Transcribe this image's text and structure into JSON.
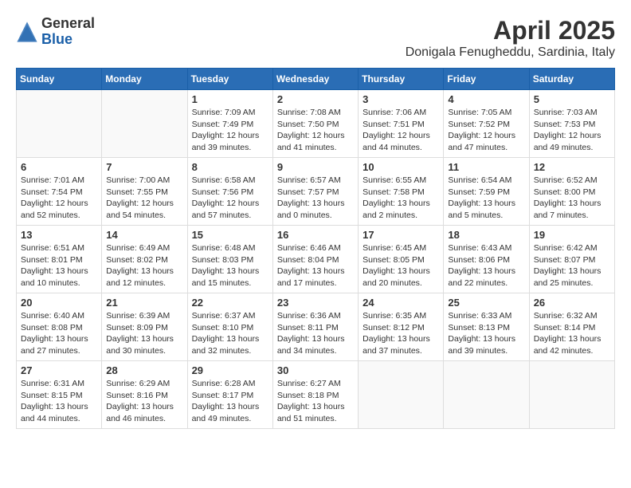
{
  "header": {
    "logo_line1": "General",
    "logo_line2": "Blue",
    "month_title": "April 2025",
    "location": "Donigala Fenugheddu, Sardinia, Italy"
  },
  "weekdays": [
    "Sunday",
    "Monday",
    "Tuesday",
    "Wednesday",
    "Thursday",
    "Friday",
    "Saturday"
  ],
  "weeks": [
    [
      {
        "day": "",
        "info": ""
      },
      {
        "day": "",
        "info": ""
      },
      {
        "day": "1",
        "info": "Sunrise: 7:09 AM\nSunset: 7:49 PM\nDaylight: 12 hours and 39 minutes."
      },
      {
        "day": "2",
        "info": "Sunrise: 7:08 AM\nSunset: 7:50 PM\nDaylight: 12 hours and 41 minutes."
      },
      {
        "day": "3",
        "info": "Sunrise: 7:06 AM\nSunset: 7:51 PM\nDaylight: 12 hours and 44 minutes."
      },
      {
        "day": "4",
        "info": "Sunrise: 7:05 AM\nSunset: 7:52 PM\nDaylight: 12 hours and 47 minutes."
      },
      {
        "day": "5",
        "info": "Sunrise: 7:03 AM\nSunset: 7:53 PM\nDaylight: 12 hours and 49 minutes."
      }
    ],
    [
      {
        "day": "6",
        "info": "Sunrise: 7:01 AM\nSunset: 7:54 PM\nDaylight: 12 hours and 52 minutes."
      },
      {
        "day": "7",
        "info": "Sunrise: 7:00 AM\nSunset: 7:55 PM\nDaylight: 12 hours and 54 minutes."
      },
      {
        "day": "8",
        "info": "Sunrise: 6:58 AM\nSunset: 7:56 PM\nDaylight: 12 hours and 57 minutes."
      },
      {
        "day": "9",
        "info": "Sunrise: 6:57 AM\nSunset: 7:57 PM\nDaylight: 13 hours and 0 minutes."
      },
      {
        "day": "10",
        "info": "Sunrise: 6:55 AM\nSunset: 7:58 PM\nDaylight: 13 hours and 2 minutes."
      },
      {
        "day": "11",
        "info": "Sunrise: 6:54 AM\nSunset: 7:59 PM\nDaylight: 13 hours and 5 minutes."
      },
      {
        "day": "12",
        "info": "Sunrise: 6:52 AM\nSunset: 8:00 PM\nDaylight: 13 hours and 7 minutes."
      }
    ],
    [
      {
        "day": "13",
        "info": "Sunrise: 6:51 AM\nSunset: 8:01 PM\nDaylight: 13 hours and 10 minutes."
      },
      {
        "day": "14",
        "info": "Sunrise: 6:49 AM\nSunset: 8:02 PM\nDaylight: 13 hours and 12 minutes."
      },
      {
        "day": "15",
        "info": "Sunrise: 6:48 AM\nSunset: 8:03 PM\nDaylight: 13 hours and 15 minutes."
      },
      {
        "day": "16",
        "info": "Sunrise: 6:46 AM\nSunset: 8:04 PM\nDaylight: 13 hours and 17 minutes."
      },
      {
        "day": "17",
        "info": "Sunrise: 6:45 AM\nSunset: 8:05 PM\nDaylight: 13 hours and 20 minutes."
      },
      {
        "day": "18",
        "info": "Sunrise: 6:43 AM\nSunset: 8:06 PM\nDaylight: 13 hours and 22 minutes."
      },
      {
        "day": "19",
        "info": "Sunrise: 6:42 AM\nSunset: 8:07 PM\nDaylight: 13 hours and 25 minutes."
      }
    ],
    [
      {
        "day": "20",
        "info": "Sunrise: 6:40 AM\nSunset: 8:08 PM\nDaylight: 13 hours and 27 minutes."
      },
      {
        "day": "21",
        "info": "Sunrise: 6:39 AM\nSunset: 8:09 PM\nDaylight: 13 hours and 30 minutes."
      },
      {
        "day": "22",
        "info": "Sunrise: 6:37 AM\nSunset: 8:10 PM\nDaylight: 13 hours and 32 minutes."
      },
      {
        "day": "23",
        "info": "Sunrise: 6:36 AM\nSunset: 8:11 PM\nDaylight: 13 hours and 34 minutes."
      },
      {
        "day": "24",
        "info": "Sunrise: 6:35 AM\nSunset: 8:12 PM\nDaylight: 13 hours and 37 minutes."
      },
      {
        "day": "25",
        "info": "Sunrise: 6:33 AM\nSunset: 8:13 PM\nDaylight: 13 hours and 39 minutes."
      },
      {
        "day": "26",
        "info": "Sunrise: 6:32 AM\nSunset: 8:14 PM\nDaylight: 13 hours and 42 minutes."
      }
    ],
    [
      {
        "day": "27",
        "info": "Sunrise: 6:31 AM\nSunset: 8:15 PM\nDaylight: 13 hours and 44 minutes."
      },
      {
        "day": "28",
        "info": "Sunrise: 6:29 AM\nSunset: 8:16 PM\nDaylight: 13 hours and 46 minutes."
      },
      {
        "day": "29",
        "info": "Sunrise: 6:28 AM\nSunset: 8:17 PM\nDaylight: 13 hours and 49 minutes."
      },
      {
        "day": "30",
        "info": "Sunrise: 6:27 AM\nSunset: 8:18 PM\nDaylight: 13 hours and 51 minutes."
      },
      {
        "day": "",
        "info": ""
      },
      {
        "day": "",
        "info": ""
      },
      {
        "day": "",
        "info": ""
      }
    ]
  ]
}
